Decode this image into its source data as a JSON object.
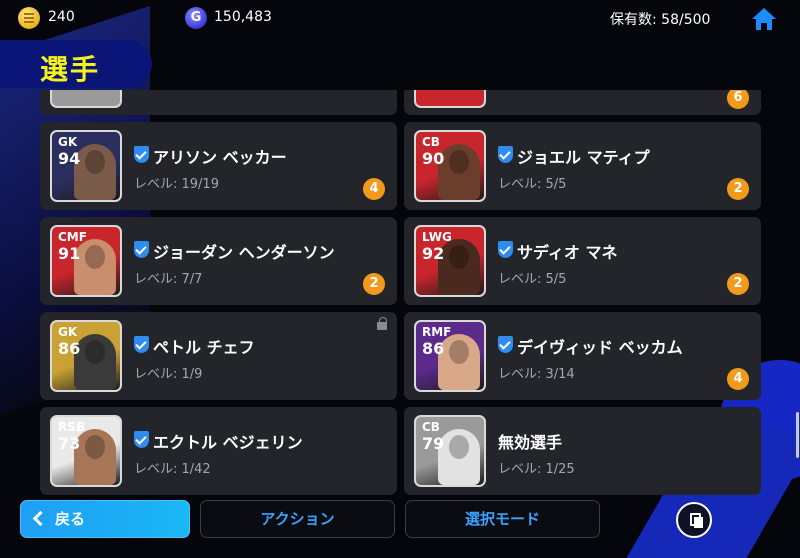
{
  "header": {
    "coins": "240",
    "gp": "150,483",
    "gp_icon_letter": "G",
    "owned": "保有数: 58/500",
    "home_icon": "home-icon"
  },
  "title": "選手",
  "partial_row": [
    {
      "badge": ""
    },
    {
      "badge": "6"
    }
  ],
  "players": [
    {
      "position": "GK",
      "rating": "94",
      "name": "アリソン ベッカー",
      "level": "レベル: 19/19",
      "badge": "4",
      "verified": true,
      "locked": false,
      "card_color": "#2b2f60",
      "face_color": "#7a5a48"
    },
    {
      "position": "CB",
      "rating": "90",
      "name": "ジョエル マティプ",
      "level": "レベル: 5/5",
      "badge": "2",
      "verified": true,
      "locked": false,
      "card_color": "#c8252c",
      "face_color": "#6b3e2c"
    },
    {
      "position": "CMF",
      "rating": "91",
      "name": "ジョーダン ヘンダーソン",
      "level": "レベル: 7/7",
      "badge": "2",
      "verified": true,
      "locked": false,
      "card_color": "#c8252c",
      "face_color": "#c98e6e"
    },
    {
      "position": "LWG",
      "rating": "92",
      "name": "サディオ マネ",
      "level": "レベル: 5/5",
      "badge": "2",
      "verified": true,
      "locked": false,
      "card_color": "#c8252c",
      "face_color": "#4a2a1e"
    },
    {
      "position": "GK",
      "rating": "86",
      "name": "ペトル チェフ",
      "level": "レベル: 1/9",
      "badge": "",
      "verified": true,
      "locked": true,
      "card_color": "#c9a233",
      "face_color": "#3a3a3a"
    },
    {
      "position": "RMF",
      "rating": "86",
      "name": "デイヴィッド ベッカム",
      "level": "レベル: 3/14",
      "badge": "4",
      "verified": true,
      "locked": false,
      "card_color": "#5b2a8a",
      "face_color": "#d8a889"
    },
    {
      "position": "RSB",
      "rating": "73",
      "name": "エクトル ベジェリン",
      "level": "レベル: 1/42",
      "badge": "",
      "verified": true,
      "locked": false,
      "card_color": "#e9e9e9",
      "face_color": "#a77658"
    },
    {
      "position": "CB",
      "rating": "79",
      "name": "無効選手",
      "level": "レベル: 1/25",
      "badge": "",
      "verified": false,
      "locked": false,
      "card_color": "#9a9a9a",
      "face_color": "#e2e2e2"
    }
  ],
  "footer": {
    "back": "戻る",
    "action": "アクション",
    "select_mode": "選択モード",
    "copy_icon": "copy-icon"
  }
}
